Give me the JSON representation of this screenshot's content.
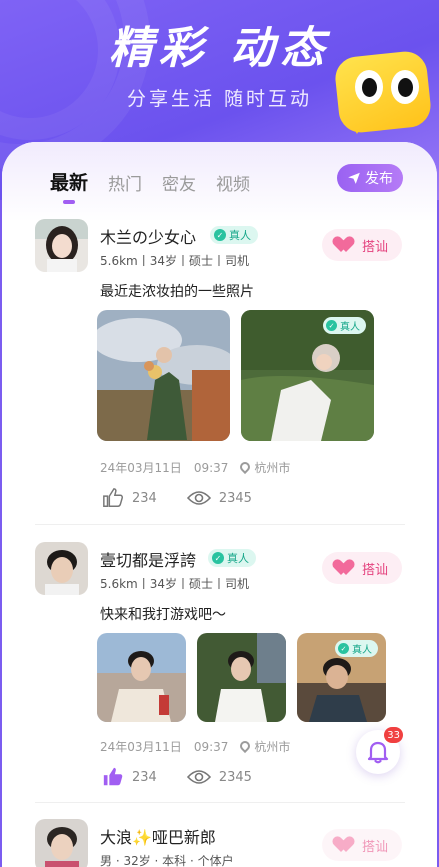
{
  "hero": {
    "title": "精彩 动态",
    "subtitle": "分享生活 随时互动"
  },
  "tabs": [
    {
      "label": "最新",
      "active": true
    },
    {
      "label": "热门",
      "active": false
    },
    {
      "label": "密友",
      "active": false
    },
    {
      "label": "视频",
      "active": false
    }
  ],
  "publish_label": "发布",
  "verified_label": "真人",
  "greet_label": "搭讪",
  "posts": [
    {
      "name": "木兰の少女心",
      "meta": "5.6km丨34岁丨硕士丨司机",
      "content": "最近走浓妆拍的一些照片",
      "date": "24年03月11日",
      "time": "09:37",
      "location": "杭州市",
      "likes": "234",
      "views": "2345"
    },
    {
      "name": "壹切都是浮誇",
      "meta": "5.6km丨34岁丨硕士丨司机",
      "content": "快来和我打游戏吧～",
      "date": "24年03月11日",
      "time": "09:37",
      "location": "杭州市",
      "likes": "234",
      "views": "2345"
    },
    {
      "name": "大浪✨哑巴新郎",
      "meta": "男 · 32岁 · 本科 · 个体户"
    }
  ],
  "notification_count": "33",
  "colors": {
    "accent": "#a15ef2",
    "greet": "#e4407d",
    "verified": "#17a78a",
    "mascot": "#ffc21a"
  }
}
